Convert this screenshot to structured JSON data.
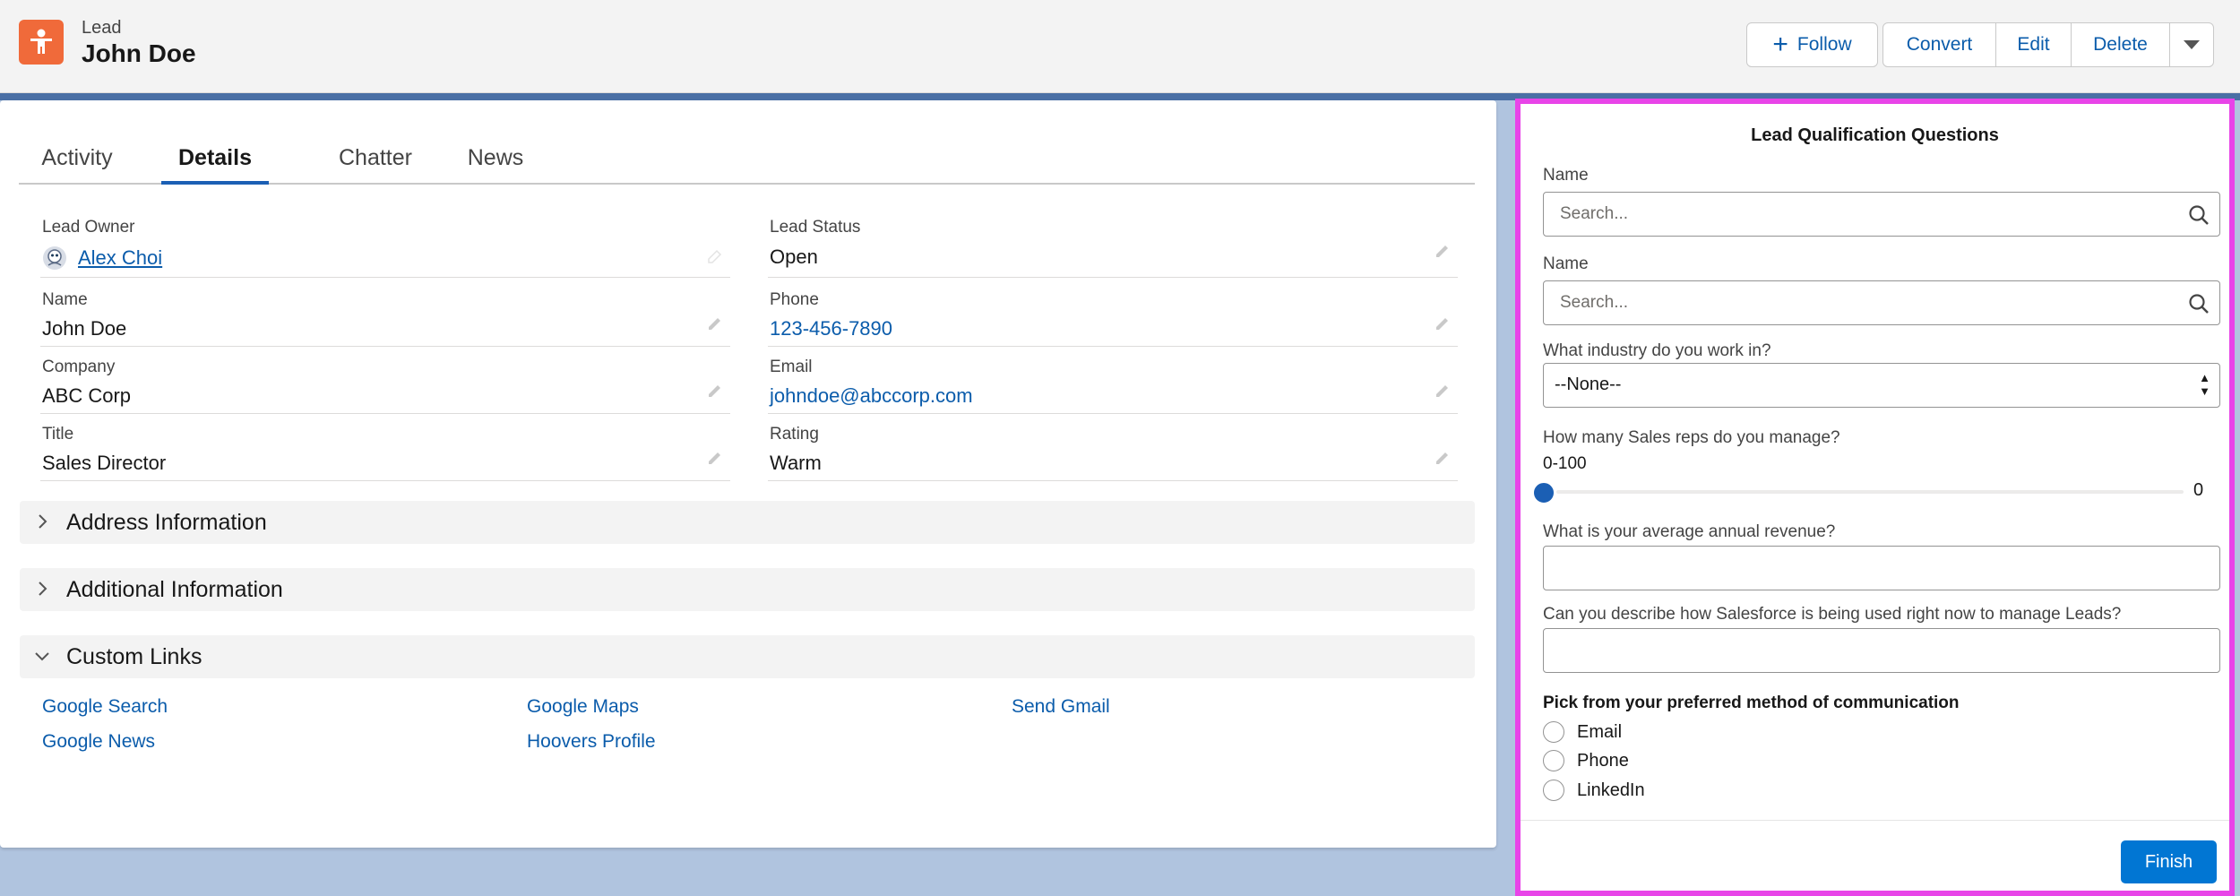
{
  "header": {
    "record_type": "Lead",
    "record_name": "John Doe",
    "icon": "lead-person-icon",
    "icon_color": "#f06a3a",
    "actions": {
      "follow": "Follow",
      "convert": "Convert",
      "edit": "Edit",
      "delete": "Delete"
    }
  },
  "tabs": {
    "activity": "Activity",
    "details": "Details",
    "chatter": "Chatter",
    "news": "News",
    "active": "Details"
  },
  "details": {
    "lead_owner": {
      "label": "Lead Owner",
      "value": "Alex Choi"
    },
    "lead_status": {
      "label": "Lead Status",
      "value": "Open"
    },
    "name": {
      "label": "Name",
      "value": "John Doe"
    },
    "phone": {
      "label": "Phone",
      "value": "123-456-7890"
    },
    "company": {
      "label": "Company",
      "value": "ABC Corp"
    },
    "email": {
      "label": "Email",
      "value": "johndoe@abccorp.com"
    },
    "title": {
      "label": "Title",
      "value": "Sales Director"
    },
    "rating": {
      "label": "Rating",
      "value": "Warm"
    }
  },
  "sections": {
    "address": "Address Information",
    "additional": "Additional Information",
    "custom_links": "Custom Links"
  },
  "custom_links": {
    "google_search": "Google Search",
    "google_maps": "Google Maps",
    "send_gmail": "Send Gmail",
    "google_news": "Google News",
    "hoovers_profile": "Hoovers Profile"
  },
  "panel": {
    "title": "Lead Qualification Questions",
    "name1_label": "Name",
    "name1_placeholder": "Search...",
    "name2_label": "Name",
    "name2_placeholder": "Search...",
    "industry_label": "What industry do you work in?",
    "industry_value": "--None--",
    "reps_label": "How many Sales reps do you manage?",
    "reps_range": "0-100",
    "reps_value": "0",
    "revenue_label": "What is your average annual revenue?",
    "salesforce_label": "Can you describe how Salesforce is being used right now to manage Leads?",
    "comm_label": "Pick from your preferred method of communication",
    "comm_options": [
      "Email",
      "Phone",
      "LinkedIn"
    ],
    "finish": "Finish",
    "highlight_color": "#e844e8"
  }
}
